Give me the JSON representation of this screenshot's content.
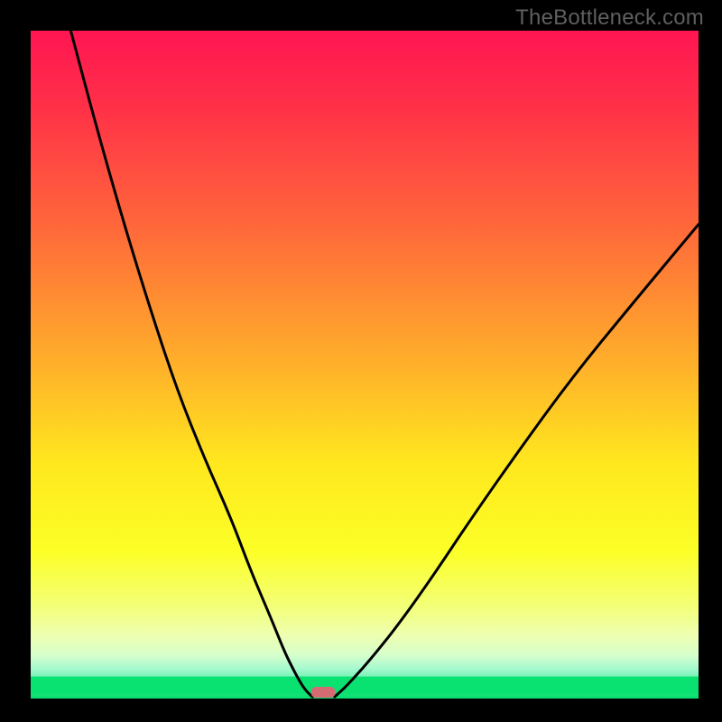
{
  "watermark": "TheBottleneck.com",
  "chart_data": {
    "type": "line",
    "title": "",
    "xlabel": "",
    "ylabel": "",
    "x_range": [
      0,
      100
    ],
    "y_range": [
      0,
      100
    ],
    "series": [
      {
        "name": "left-curve",
        "x": [
          6,
          10,
          14,
          18,
          22,
          26,
          30,
          33,
          36,
          38,
          39.5,
          40.5,
          41.2,
          41.8,
          42.2
        ],
        "y": [
          100,
          85,
          71,
          58,
          46,
          36,
          27,
          19,
          12,
          7,
          4,
          2.2,
          1.2,
          0.6,
          0.25
        ]
      },
      {
        "name": "right-curve",
        "x": [
          45.5,
          46,
          47,
          48.5,
          51,
          55,
          60,
          66,
          73,
          81,
          90,
          100
        ],
        "y": [
          0.25,
          0.7,
          1.6,
          3.2,
          6,
          11,
          18,
          27,
          37,
          48,
          59,
          71
        ]
      }
    ],
    "marker": {
      "name": "minimum-marker",
      "x_center": 43.8,
      "y": 0.0,
      "width_pct": 3.6,
      "color": "#d56b72"
    },
    "gradient_stops": [
      {
        "offset": 0.0,
        "color": "#ff1552"
      },
      {
        "offset": 0.12,
        "color": "#ff3247"
      },
      {
        "offset": 0.3,
        "color": "#ff6a3a"
      },
      {
        "offset": 0.5,
        "color": "#ffb02a"
      },
      {
        "offset": 0.65,
        "color": "#ffe81e"
      },
      {
        "offset": 0.78,
        "color": "#fcff27"
      },
      {
        "offset": 0.86,
        "color": "#f3ff76"
      },
      {
        "offset": 0.905,
        "color": "#eeffb0"
      },
      {
        "offset": 0.935,
        "color": "#d6ffcb"
      },
      {
        "offset": 0.955,
        "color": "#a7f9cf"
      },
      {
        "offset": 0.975,
        "color": "#5ceea8"
      },
      {
        "offset": 0.988,
        "color": "#23e582"
      },
      {
        "offset": 1.0,
        "color": "#05df6c"
      }
    ],
    "green_band": {
      "top_pct": 96.7,
      "bottom_pct": 99.3
    }
  }
}
